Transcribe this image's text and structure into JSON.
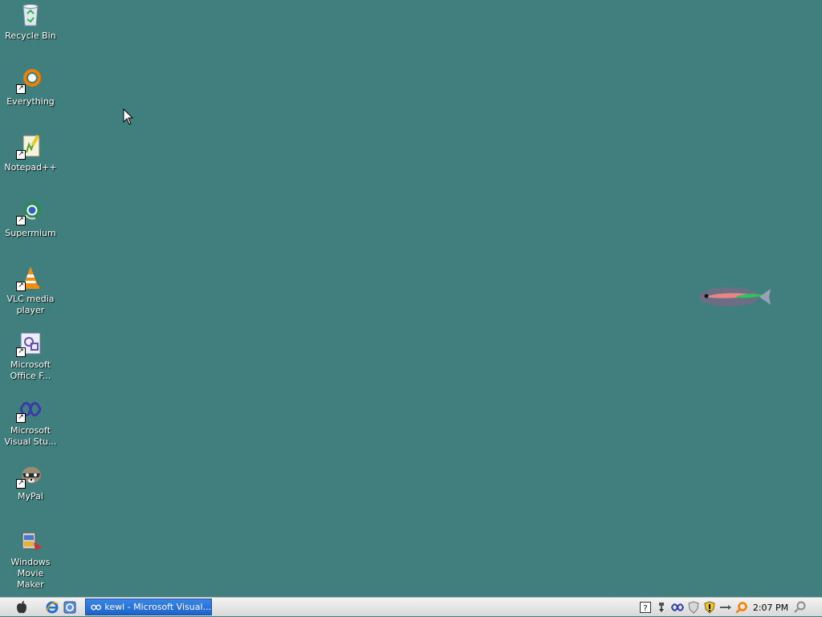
{
  "desktop": {
    "background_color": "#3f7f7d",
    "icons": [
      {
        "label": "Recycle Bin",
        "icon": "recycle-bin-icon"
      },
      {
        "label": "Everything",
        "icon": "everything-search-icon"
      },
      {
        "label": "Notepad++",
        "icon": "notepadpp-icon"
      },
      {
        "label": "Supermium",
        "icon": "supermium-browser-icon"
      },
      {
        "label": "VLC media player",
        "icon": "vlc-cone-icon"
      },
      {
        "label": "Microsoft Office F...",
        "icon": "office-icon"
      },
      {
        "label": "Microsoft Visual Stu...",
        "icon": "visual-studio-icon"
      },
      {
        "label": "MyPal",
        "icon": "mypal-raccoon-icon"
      },
      {
        "label": "Windows Movie Maker",
        "icon": "movie-maker-icon"
      }
    ]
  },
  "taskbar": {
    "start_icon": "apple-logo-icon",
    "quick_launch": [
      "internet-explorer-icon",
      "browser-icon"
    ],
    "active_task": {
      "label": "kewl - Microsoft Visual...",
      "icon": "visual-studio-icon"
    },
    "tray_icons": [
      "help-icon",
      "network-icon",
      "visual-studio-tray-icon",
      "shield-icon",
      "security-center-icon",
      "connection-icon",
      "search-orange-icon"
    ],
    "clock": "2:07 PM",
    "search_icon": "search-icon"
  }
}
